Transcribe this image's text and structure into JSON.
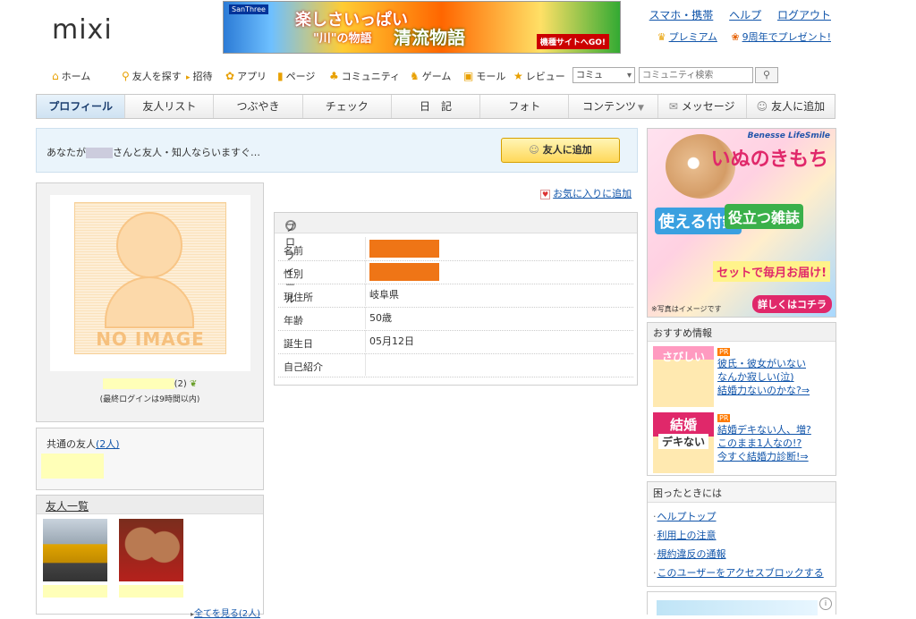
{
  "header": {
    "logo": "mixi",
    "banner": {
      "maker": "SanThree",
      "line1": "楽しさいっぱい",
      "line2": "清流物語",
      "line3": "\"川\"の物語",
      "cta": "機種サイトへGO!"
    },
    "top_links": [
      "スマホ・携帯",
      "ヘルプ",
      "ログアウト"
    ],
    "sub_links": {
      "premium": "プレミアム",
      "anniversary": "9周年でプレゼント!"
    }
  },
  "global_nav": {
    "items": [
      "ホーム",
      "友人を探す",
      "招待",
      "アプリ",
      "ページ",
      "コミュニティ",
      "ゲーム",
      "モール",
      "レビュー"
    ],
    "scope_select": "コミュ",
    "search_placeholder": "コミュニティ検索"
  },
  "tabs": [
    "プロフィール",
    "友人リスト",
    "つぶやき",
    "チェック",
    "日　記",
    "フォト",
    "コンテンツ",
    "メッセージ",
    "友人に追加"
  ],
  "friend_request": {
    "text_before": "あなたが",
    "text_after": "さんと友人・知人ならいますぐ…",
    "button": "友人に追加"
  },
  "profile_card": {
    "no_image": "NO IMAGE",
    "count": "(2)",
    "last_login": "(最終ログインは9時間以内)"
  },
  "common_friends": {
    "title": "共通の友人",
    "count": "(2人)"
  },
  "friend_list": {
    "title": "友人一覧",
    "see_all": "全てを見る(2人)"
  },
  "favorite_link": "お気に入りに追加",
  "profile_table": {
    "title": "プロフィール",
    "rows": [
      {
        "label": "名前",
        "value": ""
      },
      {
        "label": "性別",
        "value": ""
      },
      {
        "label": "現住所",
        "value": "岐阜県"
      },
      {
        "label": "年齢",
        "value": "50歳"
      },
      {
        "label": "誕生日",
        "value": "05月12日"
      },
      {
        "label": "自己紹介",
        "value": ""
      }
    ]
  },
  "ad_right": {
    "brand": "Benesse LifeSmile",
    "title": "いぬのきもち",
    "tag1": "使える付録",
    "tag2": "役立つ雑誌",
    "tag3": "セットで毎月お届け!",
    "cta": "詳しくはコチラ",
    "note": "※写真はイメージです"
  },
  "recommend": {
    "title": "おすすめ情報",
    "pr": "PR",
    "items": [
      {
        "img": "さびしい",
        "lines": [
          "彼氏・彼女がいない",
          "なんか寂しい(泣)",
          "結婚力ないのかな?⇒"
        ]
      },
      {
        "img": "結婚",
        "img2": "デキない",
        "lines": [
          "結婚デキない人、増?",
          "このまま1人なの!?",
          "今すぐ結婚力診断!⇒"
        ]
      }
    ]
  },
  "trouble": {
    "title": "困ったときには",
    "links": [
      "ヘルプトップ",
      "利用上の注意",
      "規約違反の通報",
      "このユーザーをアクセスブロックする"
    ]
  },
  "colors": {
    "link": "#1155aa",
    "accent_orange": "#ef7516",
    "highlight_yellow": "#ffffb8"
  }
}
